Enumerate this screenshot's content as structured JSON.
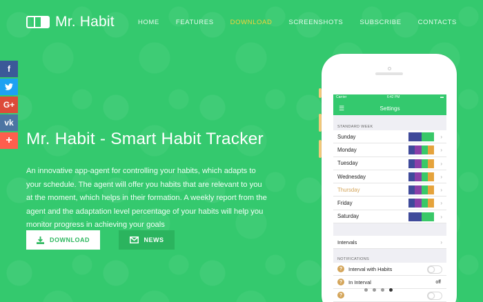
{
  "brand": {
    "name": "Mr. Habit"
  },
  "nav": [
    {
      "label": "HOME",
      "active": false
    },
    {
      "label": "FEATURES",
      "active": false
    },
    {
      "label": "DOWNLOAD",
      "active": true
    },
    {
      "label": "SCREENSHOTS",
      "active": false
    },
    {
      "label": "SUBSCRIBE",
      "active": false
    },
    {
      "label": "CONTACTS",
      "active": false
    }
  ],
  "social": [
    {
      "icon": "facebook-icon",
      "glyph": "f"
    },
    {
      "icon": "twitter-icon",
      "glyph": "t"
    },
    {
      "icon": "google-plus-icon",
      "glyph": "G+"
    },
    {
      "icon": "vk-icon",
      "glyph": "vk"
    },
    {
      "icon": "add-icon",
      "glyph": "+"
    }
  ],
  "hero": {
    "title": "Mr. Habit - Smart Habit Tracker",
    "description": "An innovative app-agent for controlling your habits, which adapts to your schedule. The agent will offer you habits that are relevant to you at the moment, which helps in their formation. A weekly report from the agent and the adaptation level percentage of your habits will help you monitor progress in achieving your goals",
    "download_label": "DOWNLOAD",
    "news_label": "NEWS"
  },
  "phone": {
    "carrier": "Carrier",
    "time": "6:42 PM",
    "screen_title": "Settings",
    "section_week": "STANDARD WEEK",
    "days": [
      {
        "label": "Sunday",
        "highlight": false,
        "colors": [
          "#3f4a9a",
          "#3f4a9a",
          "#39c868",
          "#39c868"
        ]
      },
      {
        "label": "Monday",
        "highlight": false,
        "colors": [
          "#3f4a9a",
          "#8a3fa8",
          "#39c868",
          "#e5a33c"
        ]
      },
      {
        "label": "Tuesday",
        "highlight": false,
        "colors": [
          "#3f4a9a",
          "#8a3fa8",
          "#39c868",
          "#e5a33c"
        ]
      },
      {
        "label": "Wednesday",
        "highlight": false,
        "colors": [
          "#3f4a9a",
          "#8a3fa8",
          "#39c868",
          "#e5a33c"
        ]
      },
      {
        "label": "Thursday",
        "highlight": true,
        "colors": [
          "#3f4a9a",
          "#8a3fa8",
          "#39c868",
          "#e5a33c"
        ]
      },
      {
        "label": "Friday",
        "highlight": false,
        "colors": [
          "#3f4a9a",
          "#8a3fa8",
          "#39c868",
          "#e5a33c"
        ]
      },
      {
        "label": "Saturday",
        "highlight": false,
        "colors": [
          "#3f4a9a",
          "#3f4a9a",
          "#39c868",
          "#39c868"
        ]
      }
    ],
    "intervals_label": "Intervals",
    "section_notifications": "NOTIFICATIONS",
    "interval_with_habits": "Interval with Habits",
    "in_interval": "In Interval",
    "in_interval_value": "off"
  },
  "pagination": {
    "count": 4,
    "active_index": 3
  }
}
